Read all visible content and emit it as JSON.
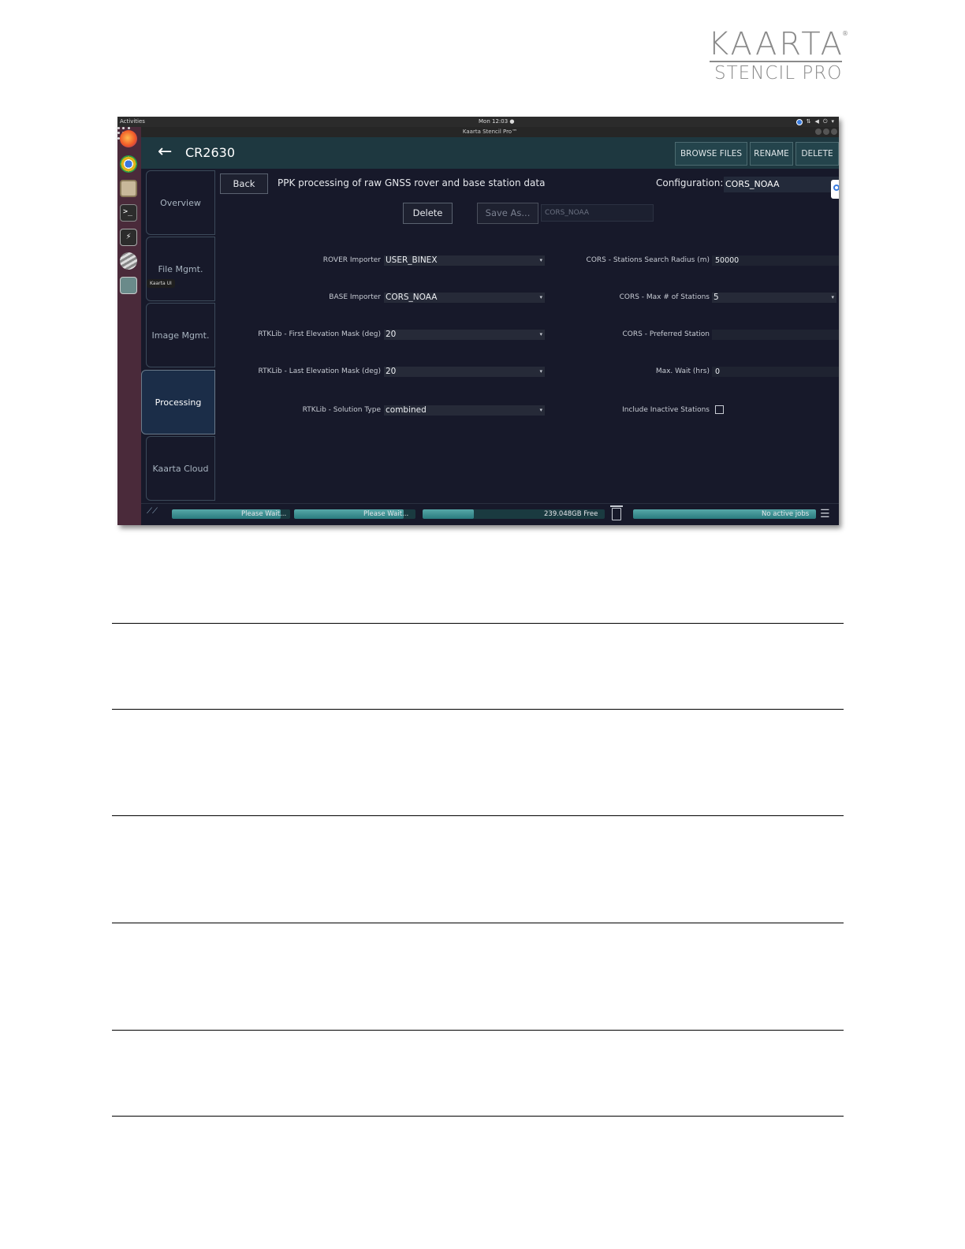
{
  "logo": {
    "line1": "KAARTA",
    "reg": "®",
    "line2": "STENCIL PRO"
  },
  "os": {
    "activities": "Activities",
    "clock": "Mon 12:03 ●",
    "window_title": "Kaarta Stencil Pro™",
    "tooltip": "Kaarta UI"
  },
  "header": {
    "title": "CR2630",
    "buttons": [
      "BROWSE FILES",
      "RENAME",
      "DELETE"
    ]
  },
  "tabs": [
    "Overview",
    "File Mgmt.",
    "Image Mgmt.",
    "Processing",
    "Kaarta Cloud"
  ],
  "active_tab": "Processing",
  "panel": {
    "back_label": "Back",
    "heading": "PPK processing of raw GNSS rover and base station data",
    "config_label": "Configuration:",
    "config_value": "CORS_NOAA",
    "delete_label": "Delete",
    "save_as_label": "Save As...",
    "save_as_value": "CORS_NOAA"
  },
  "fields_left": [
    {
      "label": "ROVER Importer",
      "value": "USER_BINEX"
    },
    {
      "label": "BASE Importer",
      "value": "CORS_NOAA"
    },
    {
      "label": "RTKLib - First Elevation Mask (deg)",
      "value": "20"
    },
    {
      "label": "RTKLib - Last Elevation Mask (deg)",
      "value": "20"
    },
    {
      "label": "RTKLib - Solution Type",
      "value": "combined"
    }
  ],
  "fields_right": [
    {
      "label": "CORS - Stations Search Radius (m)",
      "value": "50000"
    },
    {
      "label": "CORS - Max # of Stations",
      "value": "5"
    },
    {
      "label": "CORS - Preferred Station",
      "value": ""
    },
    {
      "label": "Max. Wait (hrs)",
      "value": "0"
    },
    {
      "label": "Include Inactive Stations",
      "checked": false
    }
  ],
  "statusbar": {
    "bar1_text": "Please Wait...",
    "bar1_progress": 0.92,
    "bar2_text": "Please Wait...",
    "bar2_progress": 0.9,
    "disk_text": "239.048GB Free",
    "disk_progress": 0.28,
    "jobs_text": "No active jobs",
    "jobs_progress": 1.0
  }
}
